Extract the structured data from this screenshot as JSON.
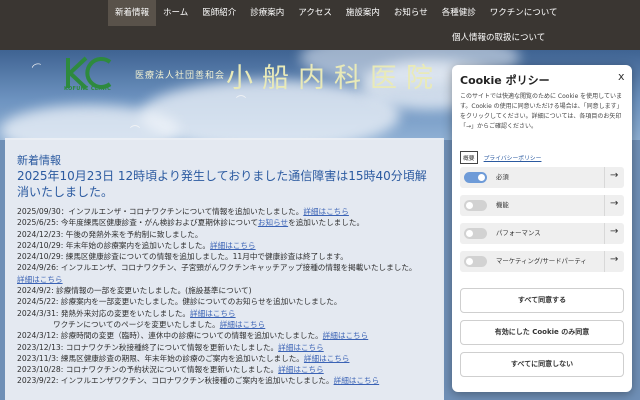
{
  "nav": {
    "items": [
      "新着情報",
      "ホーム",
      "医師紹介",
      "診療案内",
      "アクセス",
      "施設案内",
      "お知らせ",
      "各種健診",
      "ワクチンについて"
    ],
    "second_row": "個人情報の取扱について"
  },
  "hero": {
    "logo_text": "KOFUNE CLINIC",
    "corporation": "医療法人社団善和会",
    "clinic_name": "小船内科医院"
  },
  "news": {
    "title": "新着情報",
    "alert": "2025年10月23日 12時頃より発生しておりました通信障害は15時40分頃解消いたしました。",
    "items": [
      {
        "text": "2025/09/30：インフルエンザ・コロナワクチンについて情報を追加いたしました。",
        "link": "詳細はこちら",
        "tail": ""
      },
      {
        "text": "2025/6/25: 今年度練馬区健康診査・がん検診および夏期休診について",
        "link": "お知らせ",
        "tail": "を追加いたしました。"
      },
      {
        "text": "2024/12/23: 午後の発熱外来を予約制に致しました。",
        "link": "",
        "tail": ""
      },
      {
        "text": "2024/10/29: 年末年始の診療案内を追加いたしました。",
        "link": "詳細はこちら",
        "tail": ""
      },
      {
        "text": "2024/10/29: 練馬区健康診査についての情報を追加しました。11月中で健康診査は終了します。",
        "link": "",
        "tail": ""
      },
      {
        "text": "2024/9/26: インフルエンザ、コロナワクチン、子宮頸がんワクチンキャッチアップ接種の情報を掲載いたしました。",
        "link": "",
        "tail": ""
      },
      {
        "text": "",
        "link": "詳細はこちら",
        "tail": ""
      },
      {
        "text": "2024/9/2: 診療情報の一部を変更いたしました。(施設基準について)",
        "link": "",
        "tail": ""
      },
      {
        "text": "2024/5/22: 診療案内を一部変更いたしました。健診についてのお知らせを追加いたしました。",
        "link": "",
        "tail": ""
      },
      {
        "text": "2024/3/31: 発熱外来対応の変更をいたしました。",
        "link": "詳細はこちら",
        "tail": ""
      },
      {
        "text": "ワクチンについてのページを変更いたしました。",
        "link": "詳細はこちら",
        "tail": ""
      },
      {
        "text": "2024/3/12: 診療時間の変更（臨時）、連休中の診療についての情報を追加いたしました。",
        "link": "詳細はこちら",
        "tail": ""
      },
      {
        "text": "2023/12/13: コロナワクチン秋接種終了について情報を更新いたしました。",
        "link": "詳細はこちら",
        "tail": ""
      },
      {
        "text": "2023/11/3: 練馬区健康診査の期限、年末年始の診療のご案内を追加いたしました。",
        "link": "詳細はこちら",
        "tail": ""
      },
      {
        "text": "2023/10/28: コロナワクチンの予約状況について情報を更新いたしました。",
        "link": "詳細はこちら",
        "tail": ""
      },
      {
        "text": "2023/9/22: インフルエンザワクチン、コロナワクチン秋接種のご案内を追加いたしました。",
        "link": "詳細はこちら",
        "tail": ""
      }
    ]
  },
  "cookie": {
    "title": "Cookie ポリシー",
    "close": "x",
    "description": "このサイトでは快適な閲覧のために Cookie を使用しています。Cookie の使用に同意いただける場合は、「同意します」をクリックしてください。詳細については、各項目のお矢印「→」からご確認ください。",
    "details_label": "概要",
    "privacy_label": "プライバシーポリシー",
    "categories": [
      {
        "label": "必須",
        "enabled": true
      },
      {
        "label": "機能",
        "enabled": false
      },
      {
        "label": "パフォーマンス",
        "enabled": false
      },
      {
        "label": "マーケティング/サードパーティ",
        "enabled": false
      }
    ],
    "arrow": "→",
    "accept_all": "すべて同意する",
    "accept_selected": "有効にした Cookie のみ同意",
    "reject_all": "すべてに同意しない"
  },
  "colors": {
    "nav_bg": "#3a3632",
    "nav_active": "#59524a",
    "news_heading": "#2b5aa0",
    "link": "#3b63b5",
    "toggle_on": "#6e9bd8",
    "logo_green": "#2e8a3e"
  }
}
